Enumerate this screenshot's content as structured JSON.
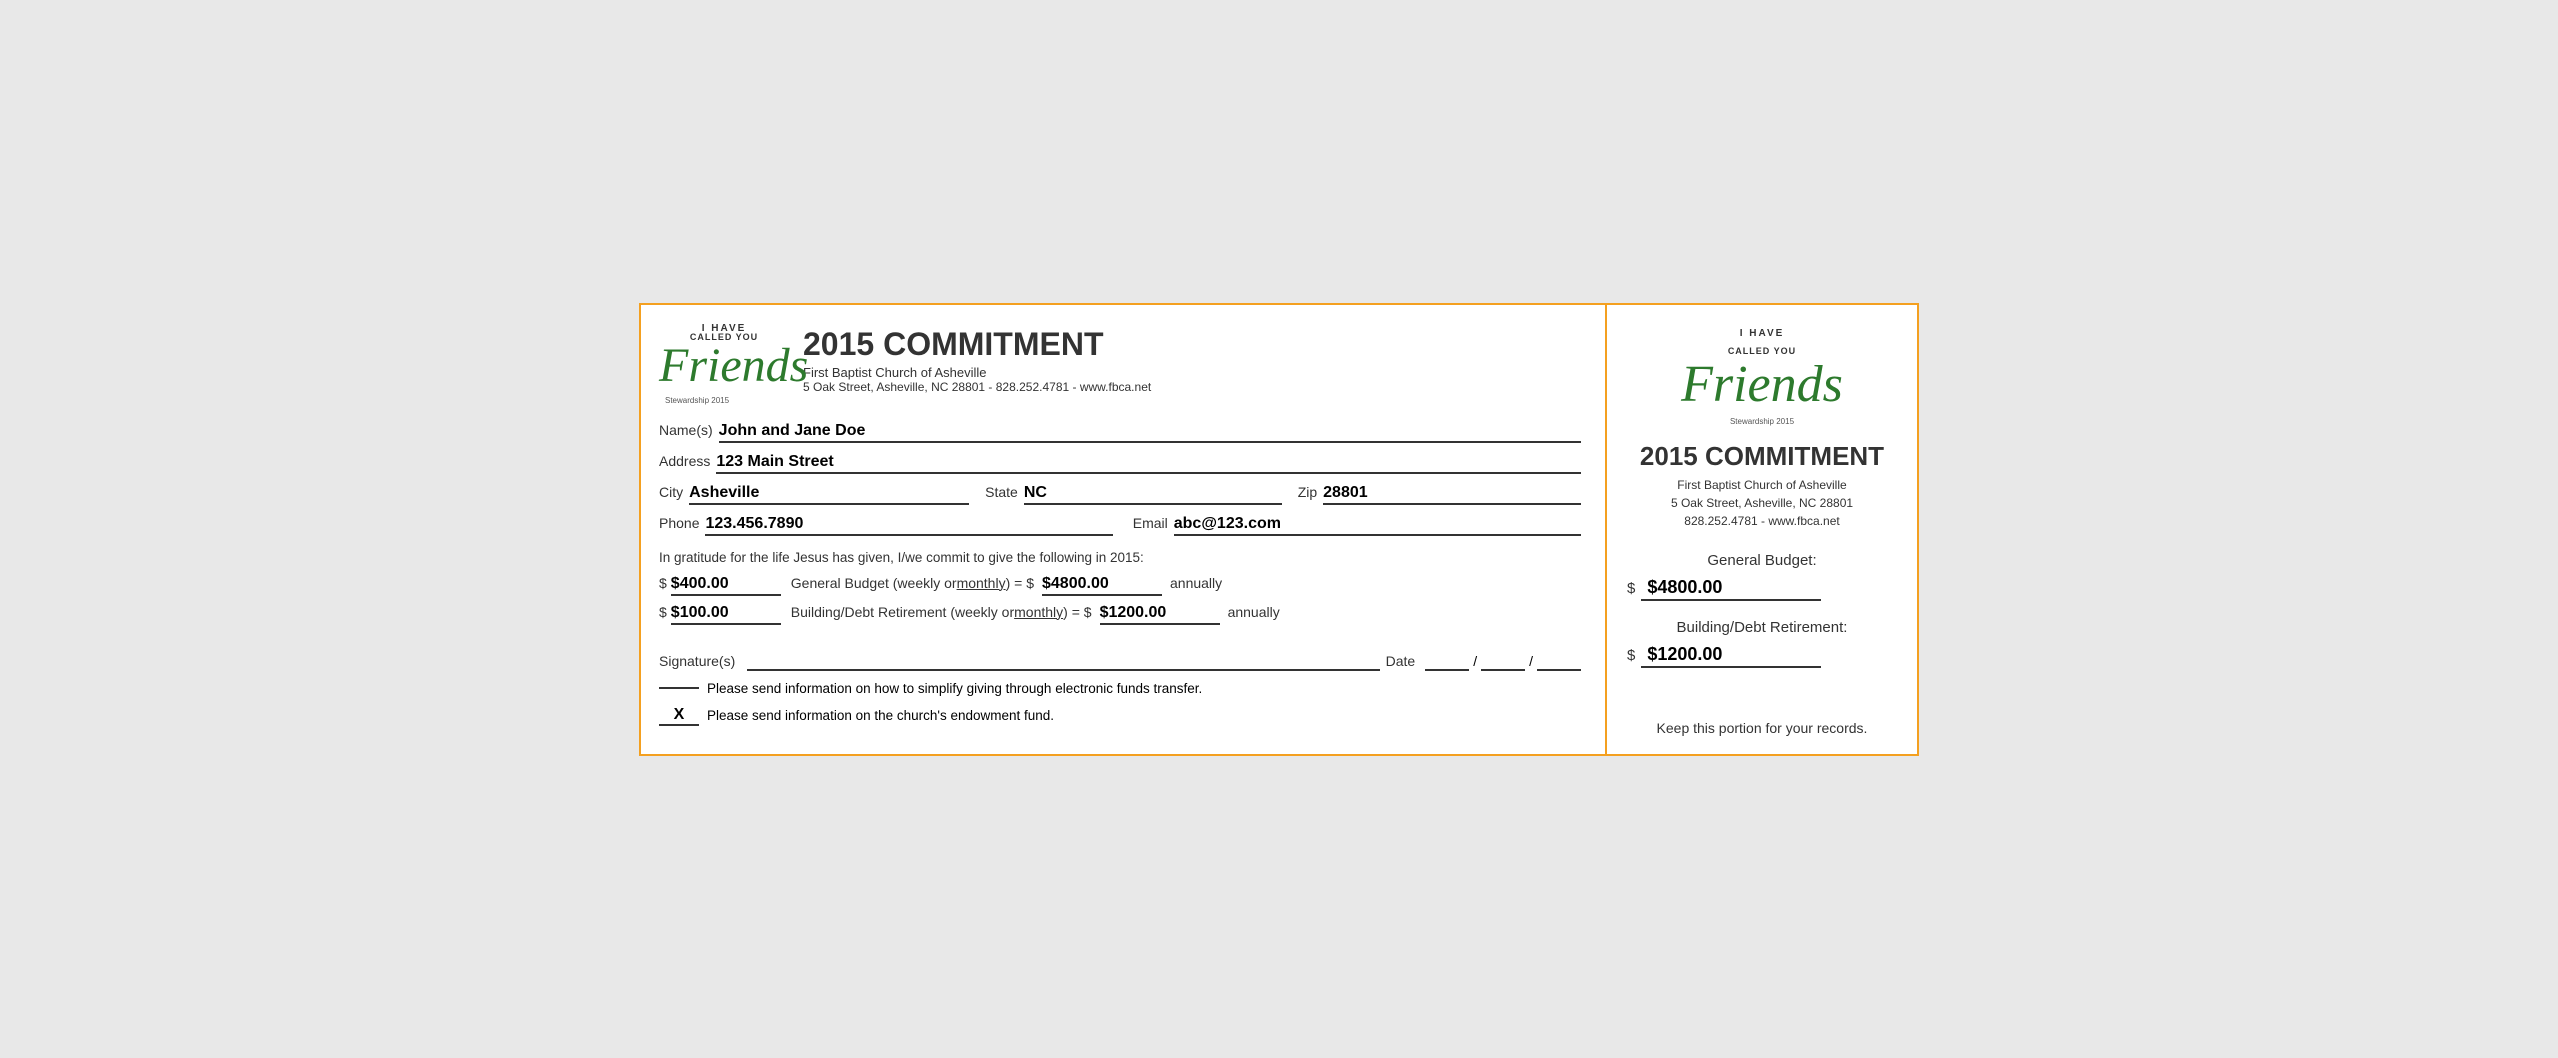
{
  "header": {
    "i_have": "I HAVE",
    "called_you": "CALLED YOU",
    "friends": "Friends",
    "stewardship": "Stewardship 2015",
    "title": "2015 COMMITMENT",
    "church": "First Baptist Church of Asheville",
    "address": "5 Oak Street, Asheville, NC  28801 - 828.252.4781 - www.fbca.net"
  },
  "form": {
    "name_label": "Name(s)",
    "name_value": "John and Jane Doe",
    "address_label": "Address",
    "address_value": "123 Main Street",
    "city_label": "City",
    "city_value": "Asheville",
    "state_label": "State",
    "state_value": "NC",
    "zip_label": "Zip",
    "zip_value": "28801",
    "phone_label": "Phone",
    "phone_value": "123.456.7890",
    "email_label": "Email",
    "email_value": "abc@123.com"
  },
  "commitment": {
    "text": "In gratitude for the life Jesus has given, I/we commit to give the following in 2015:",
    "general_prefix": "$ ",
    "general_amount": "$400.00",
    "general_label_start": "General Budget (weekly or ",
    "general_monthly": "monthly",
    "general_label_end": ") = $  ",
    "general_annual": "$4800.00",
    "general_suffix": "  annually",
    "building_prefix": "$ ",
    "building_amount": "$100.00",
    "building_label_start": "Building/Debt Retirement (weekly or ",
    "building_monthly": "monthly",
    "building_label_end": ") = $  ",
    "building_annual": "$1200.00",
    "building_suffix": "  annually"
  },
  "signature": {
    "label": "Signature(s)",
    "date_label": "Date",
    "slash1": "/",
    "slash2": "/"
  },
  "checkboxes": {
    "eft_checked": "",
    "eft_text": "Please send information on how to simplify giving through electronic funds transfer.",
    "endowment_checked": "X",
    "endowment_text": "Please send information on the church's endowment fund."
  },
  "right": {
    "i_have": "I HAVE",
    "called_you": "CALLED YOU",
    "friends": "Friends",
    "stewardship": "Stewardship 2015",
    "title": "2015 COMMITMENT",
    "church": "First Baptist Church of Asheville",
    "address_line1": "5 Oak Street, Asheville, NC  28801",
    "address_line2": "828.252.4781 - www.fbca.net",
    "general_budget_label": "General Budget:",
    "general_dollar": "$",
    "general_amount": "$4800.00",
    "building_label": "Building/Debt Retirement:",
    "building_dollar": "$",
    "building_amount": "$1200.00",
    "keep_text": "Keep this portion for your records."
  }
}
